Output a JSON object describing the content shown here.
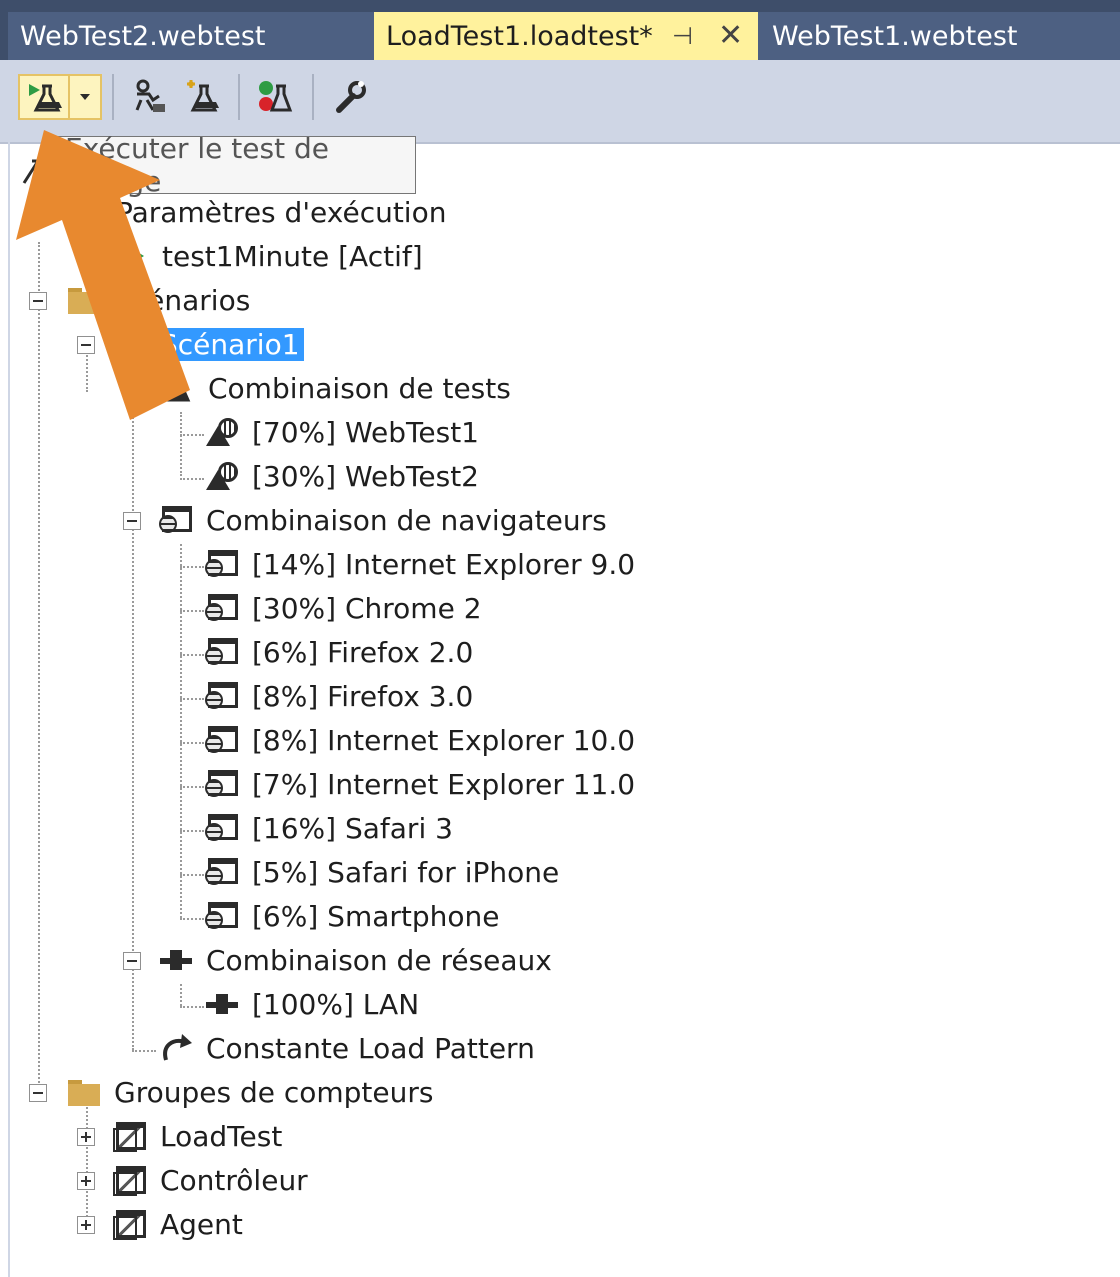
{
  "tabs": [
    {
      "label": "WebTest2.webtest",
      "active": false
    },
    {
      "label": "LoadTest1.loadtest*",
      "active": true,
      "pin_icon": "pin-icon",
      "close_icon": "close-icon"
    },
    {
      "label": "WebTest1.webtest",
      "active": false
    }
  ],
  "tab_glyphs": {
    "pin": "⊣",
    "close": "✕"
  },
  "toolbar": {
    "buttons": [
      {
        "name": "run-load-test-button",
        "icon": "run-flask-icon"
      },
      {
        "name": "run-dropdown-button",
        "icon": "dropdown-arrow-icon"
      },
      {
        "name": "add-scenario-button",
        "icon": "add-scenario-icon"
      },
      {
        "name": "add-test-button",
        "icon": "add-test-icon"
      },
      {
        "name": "manage-results-button",
        "icon": "results-flask-icon"
      },
      {
        "name": "settings-button",
        "icon": "wrench-icon"
      }
    ]
  },
  "tooltip": {
    "text": "Exécuter le test de charge"
  },
  "tree": {
    "root_visible": "",
    "run_settings": {
      "label": "Paramètres d'exécution"
    },
    "run_setting_item": {
      "label": "test1Minute [Actif]"
    },
    "scenarios": {
      "label": "Scénarios"
    },
    "scenario1": {
      "label": "Scénario1",
      "selected": true
    },
    "test_mix": {
      "label": "Combinaison de tests"
    },
    "tests": [
      {
        "label": "[70%] WebTest1"
      },
      {
        "label": "[30%] WebTest2"
      }
    ],
    "browser_mix": {
      "label": "Combinaison de navigateurs"
    },
    "browsers": [
      {
        "label": "[14%] Internet Explorer 9.0"
      },
      {
        "label": "[30%] Chrome 2"
      },
      {
        "label": "[6%] Firefox 2.0"
      },
      {
        "label": "[8%] Firefox 3.0"
      },
      {
        "label": "[8%] Internet Explorer 10.0"
      },
      {
        "label": "[7%] Internet Explorer 11.0"
      },
      {
        "label": "[16%] Safari 3"
      },
      {
        "label": "[5%] Safari for iPhone"
      },
      {
        "label": "[6%] Smartphone"
      }
    ],
    "network_mix": {
      "label": "Combinaison de réseaux"
    },
    "networks": [
      {
        "label": "[100%] LAN"
      }
    ],
    "load_pattern": {
      "label": "Constante Load Pattern"
    },
    "counter_groups": {
      "label": "Groupes de compteurs"
    },
    "counters": [
      {
        "label": "LoadTest"
      },
      {
        "label": "Contrôleur"
      },
      {
        "label": "Agent"
      }
    ]
  },
  "colors": {
    "tab_strip": "#3e4e6a",
    "active_tab": "#fff29d",
    "selection": "#3399ff",
    "arrow": "#e8892f"
  }
}
